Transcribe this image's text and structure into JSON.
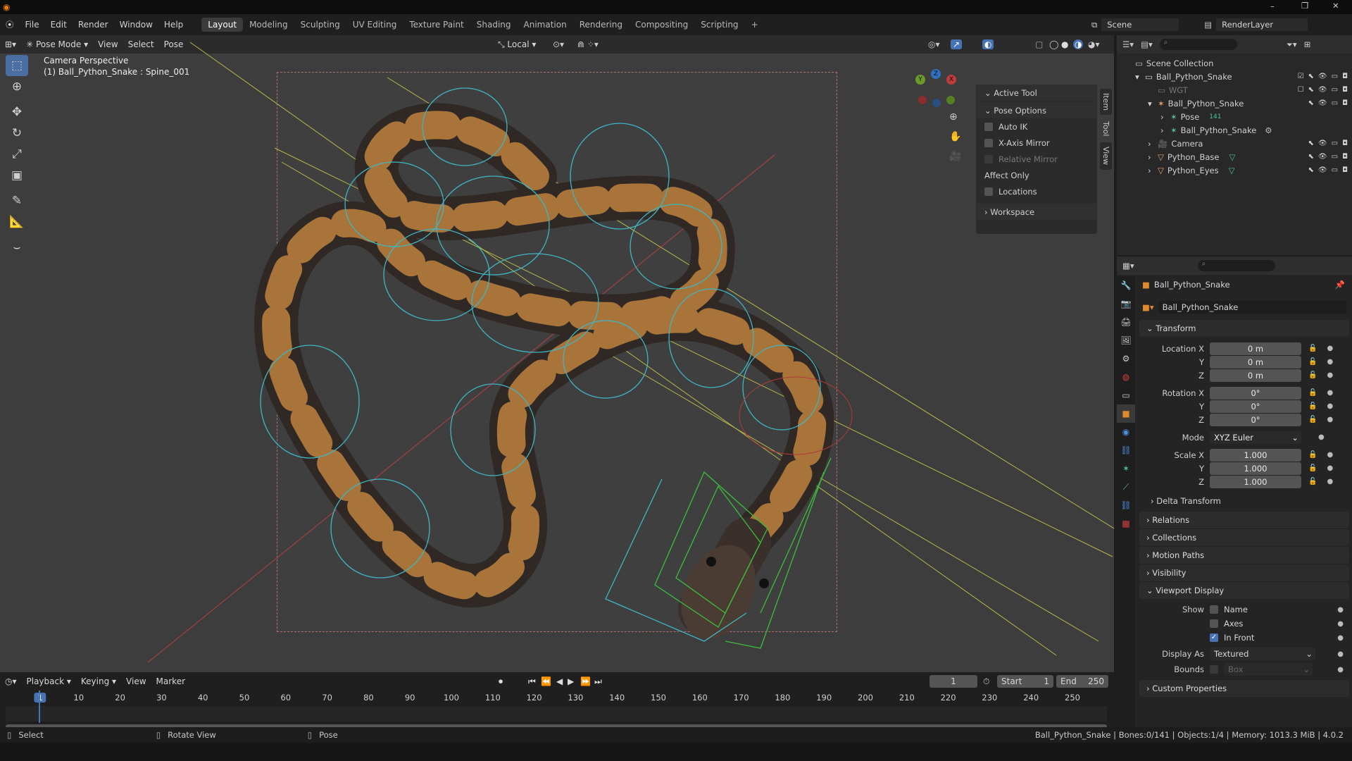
{
  "menubar": {
    "menus": [
      "File",
      "Edit",
      "Render",
      "Window",
      "Help"
    ],
    "workspaces": [
      "Layout",
      "Modeling",
      "Sculpting",
      "UV Editing",
      "Texture Paint",
      "Shading",
      "Animation",
      "Rendering",
      "Compositing",
      "Scripting"
    ],
    "active_workspace": "Layout",
    "add_tab": "+",
    "scene": "Scene",
    "view_layer": "RenderLayer"
  },
  "viewport": {
    "mode": "Pose Mode",
    "menus": [
      "View",
      "Select",
      "Pose"
    ],
    "orientation": "Local",
    "overlay_title": "Camera Perspective",
    "overlay_subtitle": "(1) Ball_Python_Snake : Spine_001",
    "gizmo": {
      "x": "X",
      "y": "Y",
      "z": "Z"
    }
  },
  "npanel": {
    "tabs": [
      "Item",
      "Tool",
      "View"
    ],
    "active_tool": "Active Tool",
    "pose_options": "Pose Options",
    "auto_ik": "Auto IK",
    "x_axis_mirror": "X-Axis Mirror",
    "relative_mirror": "Relative Mirror",
    "affect_only": "Affect Only",
    "locations": "Locations",
    "workspace": "Workspace"
  },
  "outliner": {
    "root": "Scene Collection",
    "items": [
      {
        "label": "Ball_Python_Snake",
        "depth": 1
      },
      {
        "label": "WGT",
        "depth": 2
      },
      {
        "label": "Ball_Python_Snake",
        "depth": 2
      },
      {
        "label": "Pose",
        "depth": 3
      },
      {
        "label": "Ball_Python_Snake",
        "depth": 3
      },
      {
        "label": "Camera",
        "depth": 2
      },
      {
        "label": "Python_Base",
        "depth": 2
      },
      {
        "label": "Python_Eyes",
        "depth": 2
      }
    ],
    "pose_badge": "141"
  },
  "properties": {
    "object_name": "Ball_Python_Snake",
    "data_name": "Ball_Python_Snake",
    "transform": "Transform",
    "location": {
      "label_x": "Location X",
      "label_y": "Y",
      "label_z": "Z",
      "x": "0 m",
      "y": "0 m",
      "z": "0 m"
    },
    "rotation": {
      "label_x": "Rotation X",
      "label_y": "Y",
      "label_z": "Z",
      "x": "0°",
      "y": "0°",
      "z": "0°"
    },
    "mode_label": "Mode",
    "mode_value": "XYZ Euler",
    "scale": {
      "label_x": "Scale X",
      "label_y": "Y",
      "label_z": "Z",
      "x": "1.000",
      "y": "1.000",
      "z": "1.000"
    },
    "delta_transform": "Delta Transform",
    "sections": [
      "Relations",
      "Collections",
      "Motion Paths",
      "Visibility"
    ],
    "viewport_display": "Viewport Display",
    "show_label": "Show",
    "show_name": "Name",
    "show_axes": "Axes",
    "show_in_front": "In Front",
    "display_as_label": "Display As",
    "display_as_value": "Textured",
    "bounds_label": "Bounds",
    "bounds_value": "Box",
    "custom_properties": "Custom Properties"
  },
  "timeline": {
    "menus": [
      "Playback",
      "Keying",
      "View",
      "Marker"
    ],
    "current_frame": "1",
    "start_label": "Start",
    "start": "1",
    "end_label": "End",
    "end": "250",
    "ticks": [
      "1",
      "10",
      "20",
      "30",
      "40",
      "50",
      "60",
      "70",
      "80",
      "90",
      "100",
      "110",
      "120",
      "130",
      "140",
      "150",
      "160",
      "170",
      "180",
      "190",
      "200",
      "210",
      "220",
      "230",
      "240",
      "250"
    ]
  },
  "statusbar": {
    "select": "Select",
    "rotate_view": "Rotate View",
    "pose": "Pose",
    "info": "Ball_Python_Snake | Bones:0/141 | Objects:1/4 | Memory: 1013.3 MiB | 4.0.2"
  },
  "colors": {
    "accent": "#4772b3",
    "viewport_bg": "#3d3d3d",
    "snake_dark": "#3a2f2a",
    "snake_tan": "#a8743a",
    "bone_cyan": "#3fb6c4",
    "bone_green": "#3bbf3b",
    "line_yellow": "#c9c94a",
    "axis_red": "#a33"
  }
}
